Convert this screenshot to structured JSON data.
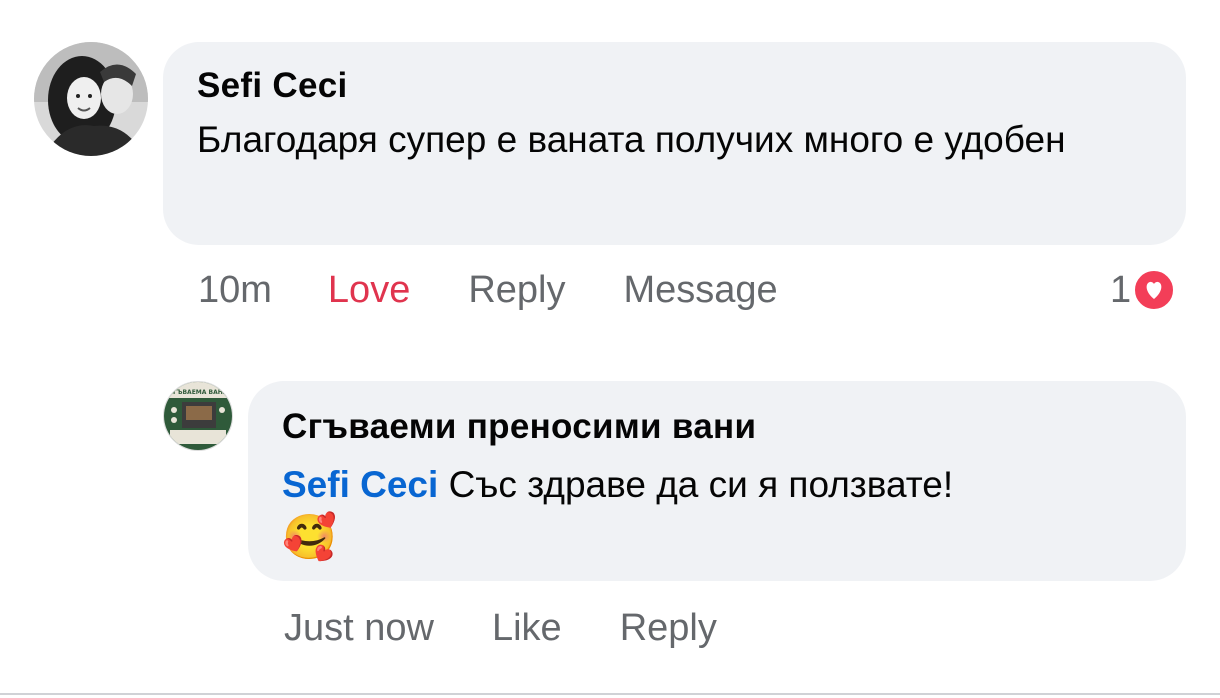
{
  "comment": {
    "author": "Sefi Ceci",
    "text": "Благодаря супер е ваната получих много е удобен",
    "time": "10m",
    "reaction_action": "Love",
    "reply_label": "Reply",
    "message_label": "Message",
    "reaction_count": "1",
    "reaction_icon": "heart-icon",
    "reaction_color": "#f33e58"
  },
  "reply": {
    "author": "Сгъваеми преносими вани",
    "mention": "Sefi Ceci",
    "text": "Със здраве да си я ползвате!",
    "emoji": "🥰",
    "time": "Just now",
    "like_label": "Like",
    "reply_label": "Reply",
    "avatar_text": "СГЪВАЕМА ВАНА"
  },
  "colors": {
    "bubble": "#f0f2f5",
    "mention": "#0866d2",
    "love": "#e0344e",
    "muted": "#65686c"
  }
}
